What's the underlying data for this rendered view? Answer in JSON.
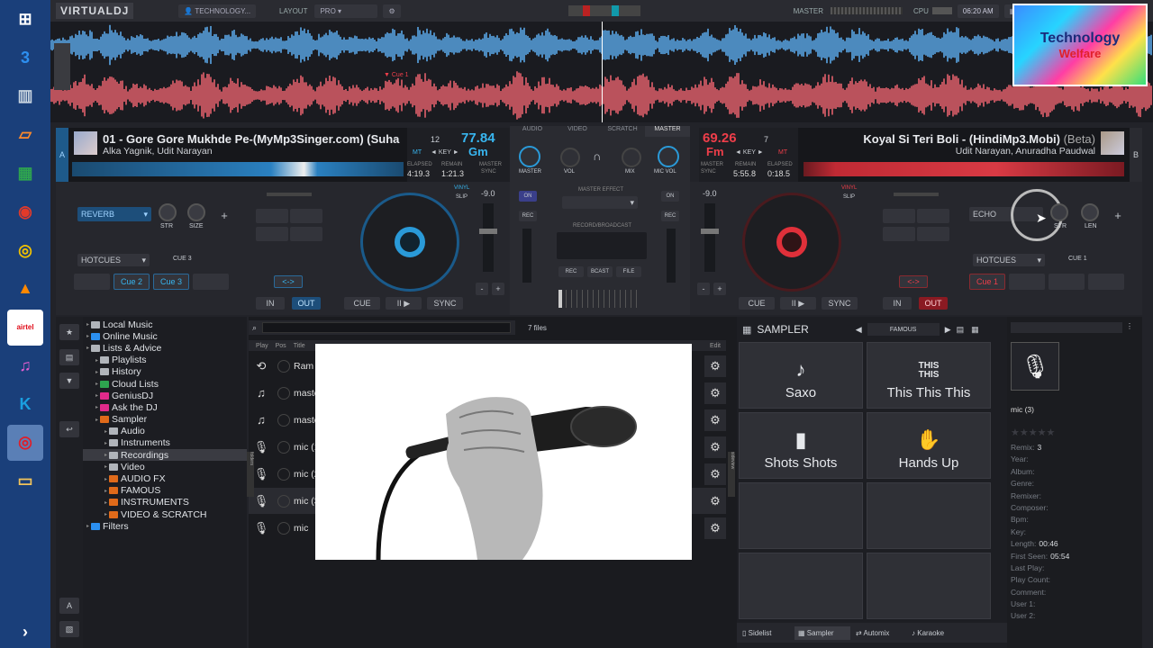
{
  "taskbar": {
    "icons": [
      {
        "name": "windows-start-icon",
        "glyph": "⊞",
        "color": "#ffffff"
      },
      {
        "name": "shield-app-icon",
        "glyph": "3",
        "color": "#2d8ff0"
      },
      {
        "name": "recycle-bin-icon",
        "glyph": "▥",
        "color": "#c8d4e0"
      },
      {
        "name": "notes-app-icon",
        "glyph": "▱",
        "color": "#ff8a2a"
      },
      {
        "name": "store-icon",
        "glyph": "▦",
        "color": "#2ea44f"
      },
      {
        "name": "record-app-icon",
        "glyph": "◉",
        "color": "#e23a2a"
      },
      {
        "name": "chrome-icon",
        "glyph": "◎",
        "color": "#f2c100"
      },
      {
        "name": "vlc-icon",
        "glyph": "▲",
        "color": "#ff8800"
      },
      {
        "name": "airtel-icon",
        "glyph": "airtel",
        "color": "#e00d1a"
      },
      {
        "name": "itunes-icon",
        "glyph": "♫",
        "color": "#e05dd0"
      },
      {
        "name": "kodi-icon",
        "glyph": "K",
        "color": "#1a9fe0"
      },
      {
        "name": "virtualdj-taskbar-icon",
        "glyph": "◎",
        "color": "#e01e28"
      },
      {
        "name": "file-explorer-icon",
        "glyph": "▭",
        "color": "#f1c35a"
      },
      {
        "name": "chevron-right-icon",
        "glyph": "›",
        "color": "#ffffff"
      }
    ]
  },
  "topbar": {
    "logo": "VIRTUALDJ",
    "account": "TECHNOLOGY...",
    "layout_label": "LAYOUT",
    "layout_value": "PRO",
    "master_label": "MASTER",
    "cpu_label": "CPU",
    "time": "06:20 AM"
  },
  "watermark": {
    "line1": "Technology",
    "line2": "Welfare"
  },
  "waveform": {
    "cue_label": "Cue 1"
  },
  "deck_a": {
    "letter": "A",
    "title": "01 - Gore Gore Mukhde Pe-(MyMp3Singer.com) (Suha",
    "artist": "Alka Yagnik, Udit Narayan",
    "bpm": "77.84",
    "pitch_num": "12",
    "key": "Gm",
    "mt": "MT",
    "key_label": "◄ KEY ►",
    "elapsed_label": "ELAPSED",
    "remain_label": "REMAIN",
    "master_label": "MASTER",
    "elapsed": "4:19.3",
    "remain": "1:21.3",
    "sync": "SYNC",
    "effect": "REVERB",
    "str": "STR",
    "size": "SIZE",
    "hotcues": "HOTCUES",
    "cue_sel": "CUE 3",
    "cue2": "Cue 2",
    "cue3": "Cue 3",
    "pitch": "-9.0",
    "vinyl": "VINYL",
    "slip": "SLIP",
    "loop": "<->",
    "in": "IN",
    "out": "OUT",
    "cue": "CUE",
    "play": "II ▶",
    "sync_btn": "SYNC",
    "minus": "-",
    "plus": "+"
  },
  "deck_b": {
    "letter": "B",
    "title": "Koyal Si Teri Boli - (HindiMp3.Mobi)",
    "title_suffix": "(Beta)",
    "artist": "Udit Narayan, Anuradha Paudwal",
    "bpm": "69.26",
    "pitch_num": "7",
    "key": "Fm",
    "mt": "MT",
    "key_label": "◄ KEY ►",
    "master_label": "MASTER",
    "sync_label": "SYNC",
    "remain_label": "REMAIN",
    "elapsed_label": "ELAPSED",
    "remain": "5:55.8",
    "elapsed": "0:18.5",
    "effect": "ECHO",
    "str": "STR",
    "len": "LEN",
    "hotcues": "HOTCUES",
    "cue_sel": "CUE 1",
    "cue1": "Cue 1",
    "pitch": "-9.0",
    "vinyl": "VINYL",
    "slip": "SLIP",
    "loop": "<->",
    "in": "IN",
    "out": "OUT",
    "cue": "CUE",
    "play": "II ▶",
    "sync_btn": "SYNC",
    "minus": "-",
    "plus": "+"
  },
  "mixer": {
    "tabs": [
      "AUDIO",
      "VIDEO",
      "SCRATCH",
      "MASTER"
    ],
    "master": "MASTER",
    "vol": "VOL",
    "mix": "MIX",
    "mic_vol": "MIC VOL",
    "on": "ON",
    "rec": "REC",
    "master_effect": "MASTER EFFECT",
    "record_broadcast": "RECORD/BROADCAST",
    "rec_btn": "REC",
    "bcast": "BCAST",
    "file": "FILE"
  },
  "browser": {
    "folders": [
      {
        "label": "Local Music",
        "color": "#b0b4ba",
        "indent": 0
      },
      {
        "label": "Online Music",
        "color": "#2b8ff0",
        "indent": 0
      },
      {
        "label": "Lists & Advice",
        "color": "#b0b4ba",
        "indent": 0
      },
      {
        "label": "Playlists",
        "color": "#b0b4ba",
        "indent": 1
      },
      {
        "label": "History",
        "color": "#b0b4ba",
        "indent": 1
      },
      {
        "label": "Cloud Lists",
        "color": "#2ea44f",
        "indent": 1
      },
      {
        "label": "GeniusDJ",
        "color": "#e02a8a",
        "indent": 1
      },
      {
        "label": "Ask the DJ",
        "color": "#e02a8a",
        "indent": 1
      },
      {
        "label": "Sampler",
        "color": "#e06a1a",
        "indent": 1
      },
      {
        "label": "Audio",
        "color": "#b0b4ba",
        "indent": 2
      },
      {
        "label": "Instruments",
        "color": "#b0b4ba",
        "indent": 2
      },
      {
        "label": "Recordings",
        "color": "#b0b4ba",
        "indent": 2,
        "selected": true
      },
      {
        "label": "Video",
        "color": "#b0b4ba",
        "indent": 2
      },
      {
        "label": "AUDIO FX",
        "color": "#e06a1a",
        "indent": 2
      },
      {
        "label": "FAMOUS",
        "color": "#e06a1a",
        "indent": 2
      },
      {
        "label": "INSTRUMENTS",
        "color": "#e06a1a",
        "indent": 2
      },
      {
        "label": "VIDEO & SCRATCH",
        "color": "#e06a1a",
        "indent": 2
      },
      {
        "label": "Filters",
        "color": "#2b8ff0",
        "indent": 0
      }
    ],
    "file_count": "7 files",
    "cols": [
      "Play",
      "Pos",
      "Title"
    ],
    "edit": "Edit",
    "folders_tab": "folders",
    "sideview_tab": "sideview",
    "rows": [
      {
        "icon": "⟲",
        "title": "Ram I"
      },
      {
        "icon": "♫",
        "title": "maste"
      },
      {
        "icon": "♫",
        "title": "maste"
      },
      {
        "icon": "🎙",
        "title": "mic (1"
      },
      {
        "icon": "🎙",
        "title": "mic (2"
      },
      {
        "icon": "🎙",
        "title": "mic (3"
      },
      {
        "icon": "🎙",
        "title": "mic"
      }
    ]
  },
  "sampler": {
    "title": "SAMPLER",
    "bank": "FAMOUS",
    "pads": [
      {
        "label": "Saxo",
        "glyph": "♪"
      },
      {
        "label": "This This This",
        "glyph": "THIS\nTHIS"
      },
      {
        "label": "Shots Shots",
        "glyph": "▮"
      },
      {
        "label": "Hands Up",
        "glyph": "✋"
      }
    ]
  },
  "bottom_tabs": [
    "Sidelist",
    "Sampler",
    "Automix",
    "Karaoke"
  ],
  "info": {
    "track": "mic (3)",
    "stars": "★★★★★",
    "fields": [
      {
        "k": "Remix:",
        "v": "3"
      },
      {
        "k": "Year:",
        "v": ""
      },
      {
        "k": "Album:",
        "v": ""
      },
      {
        "k": "Genre:",
        "v": ""
      },
      {
        "k": "Remixer:",
        "v": ""
      },
      {
        "k": "Composer:",
        "v": ""
      },
      {
        "k": "Bpm:",
        "v": ""
      },
      {
        "k": "Key:",
        "v": ""
      },
      {
        "k": "Length:",
        "v": "00:46"
      },
      {
        "k": "First Seen:",
        "v": "05:54"
      },
      {
        "k": "Last Play:",
        "v": ""
      },
      {
        "k": "Play Count:",
        "v": ""
      },
      {
        "k": "Comment:",
        "v": ""
      },
      {
        "k": "User 1:",
        "v": ""
      },
      {
        "k": "User 2:",
        "v": ""
      }
    ]
  }
}
